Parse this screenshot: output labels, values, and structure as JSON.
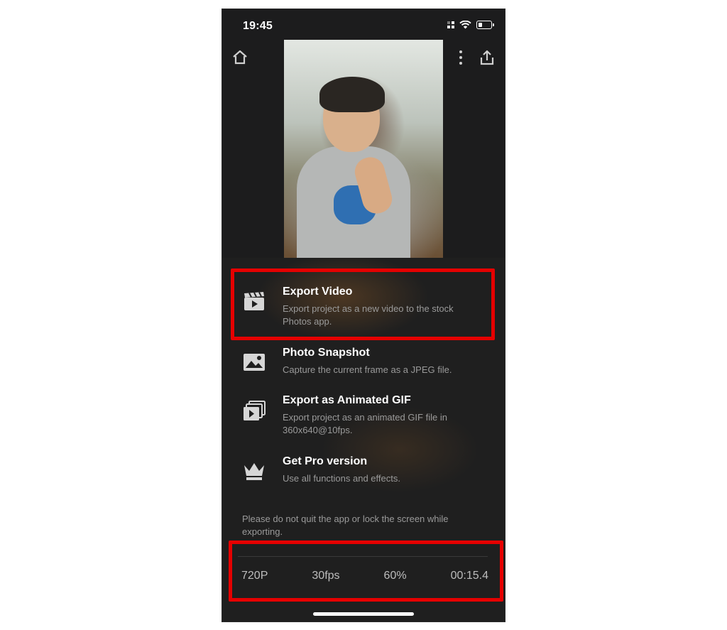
{
  "status_bar": {
    "time": "19:45"
  },
  "toolbar": {
    "home_icon": "home-icon",
    "more_icon": "more-vertical-icon",
    "share_icon": "share-icon"
  },
  "export_options": [
    {
      "icon": "video-clapper-icon",
      "title": "Export Video",
      "description": "Export project as a new video to the stock Photos app."
    },
    {
      "icon": "photo-icon",
      "title": "Photo Snapshot",
      "description": "Capture the current frame as a JPEG file."
    },
    {
      "icon": "gif-stack-icon",
      "title": "Export as Animated GIF",
      "description": "Export project as an animated GIF file in 360x640@10fps."
    },
    {
      "icon": "crown-icon",
      "title": "Get Pro version",
      "description": "Use all functions and effects."
    }
  ],
  "note": "Please do not quit the app or lock the screen while exporting.",
  "export_settings": {
    "resolution": "720P",
    "frame_rate": "30fps",
    "quality": "60%",
    "duration": "00:15.4"
  },
  "colors": {
    "highlight": "#e60000",
    "background": "#1f1f1f",
    "text_primary": "#ffffff",
    "text_secondary": "#9a9a9a"
  }
}
